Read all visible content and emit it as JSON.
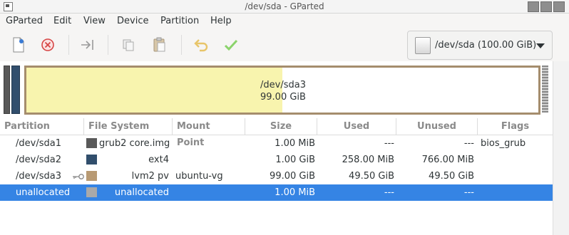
{
  "window": {
    "title": "/dev/sda - GParted"
  },
  "menu": [
    "GParted",
    "Edit",
    "View",
    "Device",
    "Partition",
    "Help"
  ],
  "toolbar": {
    "buttons": [
      "new-icon",
      "delete-icon",
      "resize-move-icon",
      "copy-icon",
      "paste-icon",
      "undo-icon",
      "apply-icon"
    ],
    "device_selector": "/dev/sda (100.00 GiB)"
  },
  "disk_map": {
    "selected_partition": "/dev/sda3",
    "selected_size": "99.00 GiB",
    "used_fraction": 0.5,
    "colors": {
      "border": "#a58d6d",
      "used": "#f8f4ae"
    }
  },
  "table": {
    "columns": [
      "Partition",
      "File System",
      "Mount Point",
      "Size",
      "Used",
      "Unused",
      "Flags"
    ],
    "rows": [
      {
        "partition": "/dev/sda1",
        "fs": "grub2 core.img",
        "mount": "",
        "size": "1.00 MiB",
        "used": "---",
        "unused": "---",
        "flags": "bios_grub",
        "color": "#595959",
        "key": false,
        "selected": false
      },
      {
        "partition": "/dev/sda2",
        "fs": "ext4",
        "mount": "",
        "size": "1.00 GiB",
        "used": "258.00 MiB",
        "unused": "766.00 MiB",
        "flags": "",
        "color": "#314e6c",
        "key": false,
        "selected": false
      },
      {
        "partition": "/dev/sda3",
        "fs": "lvm2 pv",
        "mount": "ubuntu-vg",
        "size": "99.00 GiB",
        "used": "49.50 GiB",
        "unused": "49.50 GiB",
        "flags": "",
        "color": "#b89a73",
        "key": true,
        "selected": false
      },
      {
        "partition": "unallocated",
        "fs": "unallocated",
        "mount": "",
        "size": "1.00 MiB",
        "used": "---",
        "unused": "---",
        "flags": "",
        "color": "#a9a9a9",
        "key": false,
        "selected": true
      }
    ]
  }
}
